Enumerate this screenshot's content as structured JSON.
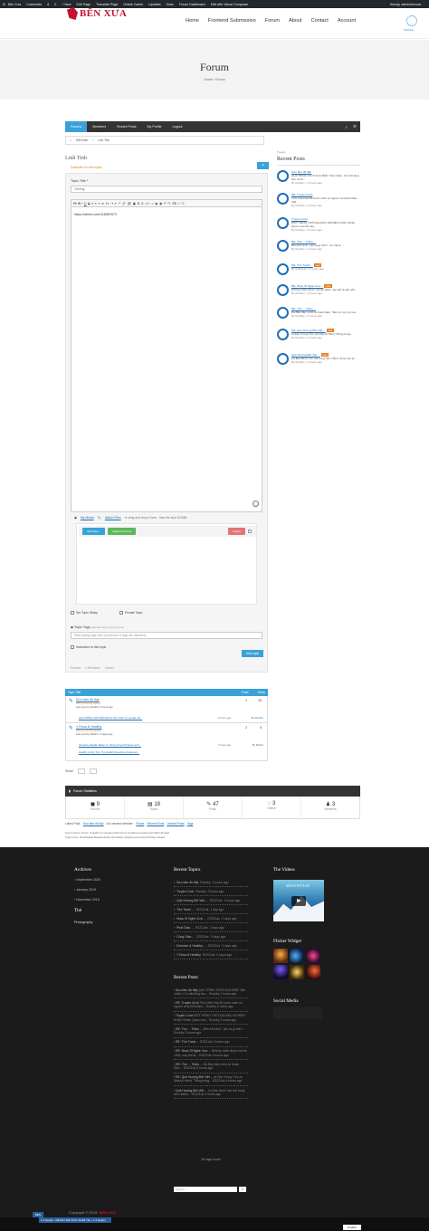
{
  "adminbar": {
    "items": [
      "Bến Xưa",
      "Customize",
      "8",
      "0",
      "+ New",
      "Edit Page",
      "Translate Page",
      "Delete Cache",
      "Updates",
      "Snax",
      "Forum Dashboard",
      "Edit with Visual Composer"
    ],
    "howdy": "Howdy, adminbenxua"
  },
  "header": {
    "logo_text": "BẾN XƯA",
    "nav": [
      "Home",
      "Frontend Submission",
      "Forum",
      "About",
      "Contact",
      "Account"
    ],
    "loading_text": "Working"
  },
  "hero": {
    "title": "Forum",
    "breadcrumb": "Home › Forum"
  },
  "forum_tabs": [
    "Forums",
    "Members",
    "Recent Posts",
    "My Profile",
    "Logout"
  ],
  "crumbs": [
    "Diễn Đàn",
    "Linh Tinh"
  ],
  "form": {
    "forum_name": "Linh Tinh",
    "subscribe_text": "Subscribe for new topics",
    "close_label": "×",
    "topic_title_label": "Topic Title *",
    "topic_title_value": "Trường",
    "editor_content": "https://vimeo.com/118087673",
    "media_link": "My Media",
    "attach_link": "Attach Files",
    "attach_note": "or drag and drop it here - Max file size 512MB",
    "add_files": "Add Files...",
    "attach_post": "Attach Into Post",
    "delete": "Delete",
    "set_sticky": "Set Topic Sticky",
    "private_topic": "Private Topic",
    "tags_label": "Topic Tags",
    "tags_note": "(Separate tags using a comma)",
    "tags_placeholder": "Start typing tags here (maximum 5 tags are allowed)...",
    "subscribe_topic": "Subscribe to this topic",
    "add_topic_button": "Add topic",
    "revisions": [
      "Preview",
      "0 Revisions",
      "Cancel"
    ]
  },
  "sidebar": {
    "small_label": "Tweets",
    "title": "Recent Posts",
    "posts": [
      {
        "title": "Sưu tầm đồ đấy",
        "excerpt": "QUA TRÌNG GIỮA SỰA BÂN \"bắn nhắm, Có mặt tăng cho nước...",
        "meta": "By Rockby • 2 hours ago",
        "badge": ""
      },
      {
        "title": "RE: Truyện Cười",
        "excerpt": "Thời Việt Hoà 59 bước cách cô ngược ta là Đỗ khâm thật...",
        "meta": "By Rockby • 3 hours ago",
        "badge": ""
      },
      {
        "title": "Truyện Cười",
        "excerpt": "MỘT TIẾNG THỜI ĐẠI ĐÂU NGHIỆN KHÁC Nhiều Quan vừa bởi nay...",
        "meta": "By Rockby • 4 hours ago",
        "badge": ""
      },
      {
        "title": "RE: Thơ ... Thiếu ...",
        "excerpt": "Bến Kết sinh \" yêu là gì tình? - tìm được ...",
        "meta": "By Rockby • 4 hours ago",
        "badge": ""
      },
      {
        "title": "RE: Thơ Tranh ...",
        "excerpt": "",
        "meta": "By R2221ds • 4 hours ago",
        "badge": "new"
      },
      {
        "title": "RE: Nhạc Sĩ Nghe Xưa ...",
        "excerpt": "Những chiều được mà ba 1961, nay bởi là vận gởi...",
        "meta": "By Rockby • 4 hours ago",
        "badge": "new"
      },
      {
        "title": "RE: Thơ ... Thiếu ...",
        "excerpt": "Bà Bầu đàn nước ai Xuân Diệu: \"Đến từ còn gì xưa...",
        "meta": "By Rockby • 4 hours ago",
        "badge": ""
      },
      {
        "title": "RE: Quê Hương Bởi Việt ...",
        "excerpt": "Ai Đàn Trong Thơ và Nhạc(4 Hiền) \"Tiếng trong...",
        "meta": "By Rockby • 4 hours ago",
        "badge": "new"
      },
      {
        "title": "Quê Hương Bởi Việt ...",
        "excerpt": "Ca Đàn Bình Yên trai trong hồn nhiễm Ta là nhớ là ...",
        "meta": "By Rockby • 4 hours ago",
        "badge": "new"
      }
    ]
  },
  "topics": {
    "header": {
      "title": "Topic Title",
      "posts": "Posts",
      "views": "Views"
    },
    "rows": [
      {
        "title": "Sưu tầm đồ đấy",
        "sub": "Short post and replies",
        "last": "Last post by Rockby 2 hours ago",
        "reply": "QUA TRÌNG GIỚI MÀN ĐỊCH 70s: nhắc Có sự kiện đồ...",
        "posts": "1",
        "views": "23",
        "reply_time": "1 hours ago",
        "reply_by": "By Rockby"
      },
      {
        "title": "Y Khoa & Healthy",
        "sub": "Short post and replies",
        "last": "Last post by R2221 • 2 days ago",
        "reply": "Glossary Details: Mater vs. Wrong Food Choices at th...",
        "reply2": "Healthy Living Tips: Top Health Questions Answered...",
        "posts": "2",
        "views": "5",
        "reply_time": "5 days ago",
        "reply_by": "By R2221"
      }
    ]
  },
  "share_label": "Share",
  "stats": {
    "title": "Forum Statistics",
    "cells": [
      {
        "n": "9",
        "l": "Forums"
      },
      {
        "n": "18",
        "l": "Topics"
      },
      {
        "n": "47",
        "l": "Posts"
      },
      {
        "n": "3",
        "l": "Online"
      },
      {
        "n": "3",
        "l": "Members"
      }
    ],
    "latest_post_label": "Latest Post:",
    "latest_post": "Sưu tầm đồ đấy",
    "newest_member_label": "Our newest member:",
    "newest_member": "Rocke",
    "recent_posts": "Recent Posts",
    "unread_posts": "Unread Posts",
    "tags": "Tags",
    "legend1": "Forum Icons:  Forum contains no unread posts   Forum contains unread posts   Mark all read",
    "legend2": "Topic Icons:  Not Replied   Replied   Active   Hot   Sticky   Unapproved   Solved   Private   Closed"
  },
  "footer": {
    "archives_title": "Archives",
    "archives": [
      "September 2020",
      "January 2019",
      "November 2015"
    ],
    "tags_title": "Thẻ",
    "tags": [
      "Photography"
    ],
    "recent_topics_title": "Recent Topics",
    "recent_topics": [
      {
        "t": "Sưu tầm đồ đấy",
        "by": "Rockby",
        "d": "1 hours ago"
      },
      {
        "t": "Truyện Cười",
        "by": "Rockby",
        "d": "2 hours ago"
      },
      {
        "t": "Quê Hương Bởi Việt ...",
        "by": "R2221ds",
        "d": "1 hours ago"
      },
      {
        "t": "Thơ Tranh ...",
        "by": "R2221ds",
        "d": "1 day ago"
      },
      {
        "t": "Nhạc Sĩ Nghe Xưa ...",
        "by": "R2221ds",
        "d": "2 days ago"
      },
      {
        "t": "Phát Giáo ...",
        "by": "R2221ds",
        "d": "2 days ago"
      },
      {
        "t": "Công Giáo ...",
        "by": "R2221ds",
        "d": "2 days ago"
      },
      {
        "t": "Exercise & Healthy ...",
        "by": "R2221ds",
        "d": "3 days ago"
      },
      {
        "t": "Y Khoa & Healthy",
        "by": "R2221ds",
        "d": "5 days ago"
      }
    ],
    "recent_posts_title": "Recent Posts",
    "recent_posts": [
      {
        "t": "Sưu tầm đồ đấy",
        "ex": "QUA TRÌNG GIỮA SỰA BÂN \"bắn nhắm, Có mặt tăng cho...",
        "by": "Rockby",
        "d": "1 hours ago"
      },
      {
        "t": "RE: Truyện Cười",
        "ex": "Thời Việt Hoà 59 bước cách cô ngược ta là Đỗ khâm...",
        "by": "Rockby",
        "d": "2 hours ago"
      },
      {
        "t": "Truyện Cười",
        "ex": "MỘT TIẾNG THỜI ĐẠI ĐÂU NGHIỆN KHÁC Nhiều Quan vừa...",
        "by": "Rockby",
        "d": "2 hours ago"
      },
      {
        "t": "RE: Thơ ... Thiếu ...",
        "ex": "Bến Kết sinh \" yêu là gì tình? ...",
        "by": "Rockby",
        "d": "3 hours ago"
      },
      {
        "t": "RE: Thơ Tranh ...",
        "ex": "",
        "by": "R2221ds",
        "d": "3 hours ago"
      },
      {
        "t": "RE: Nhạc Sĩ Nghe Xưa ...",
        "ex": "Những chiều được mà ba 1961, nay bởi là...",
        "by": "R2221ds",
        "d": "3 hours ago"
      },
      {
        "t": "RE: Thơ ... Thiếu ...",
        "ex": "Bà Bầu đàn nước ai Xuân Diệu...",
        "by": "R2221ds",
        "d": "3 hours ago"
      },
      {
        "t": "RE: Quê Hương Bởi Việt ...",
        "ex": "Ai Đàn Trong Thơ và Nhạc(4 Hiền) \"Tiếng trong...",
        "by": "R2221ds",
        "d": "4 hours ago"
      },
      {
        "t": "Quê Hương Bởi Việt ...",
        "ex": "Ca Đàn Bình Yên trai trong hồn nhiễm...",
        "by": "R2221ds",
        "d": "4 hours ago"
      }
    ],
    "no_tags": "No tags found",
    "search_placeholder": "Search ...",
    "videos_title": "The Videos",
    "video_label": "MOUNTAIN",
    "flickr_title": "Flicker Widget",
    "social_title": "Social Media",
    "copyright_prefix": "Copyright © 2019.",
    "copyright_brand": "BẾN XƯA",
    "strip_text": "1.4 Quyền - Đã Nhớ Mới Thời Xa Đã Yêu - 1.4 Quyền",
    "mini_label": "BEN",
    "language": "English"
  },
  "colors": {
    "brand": "#c8102e",
    "accent": "#3aa1d8",
    "link": "#1e6fb5"
  }
}
